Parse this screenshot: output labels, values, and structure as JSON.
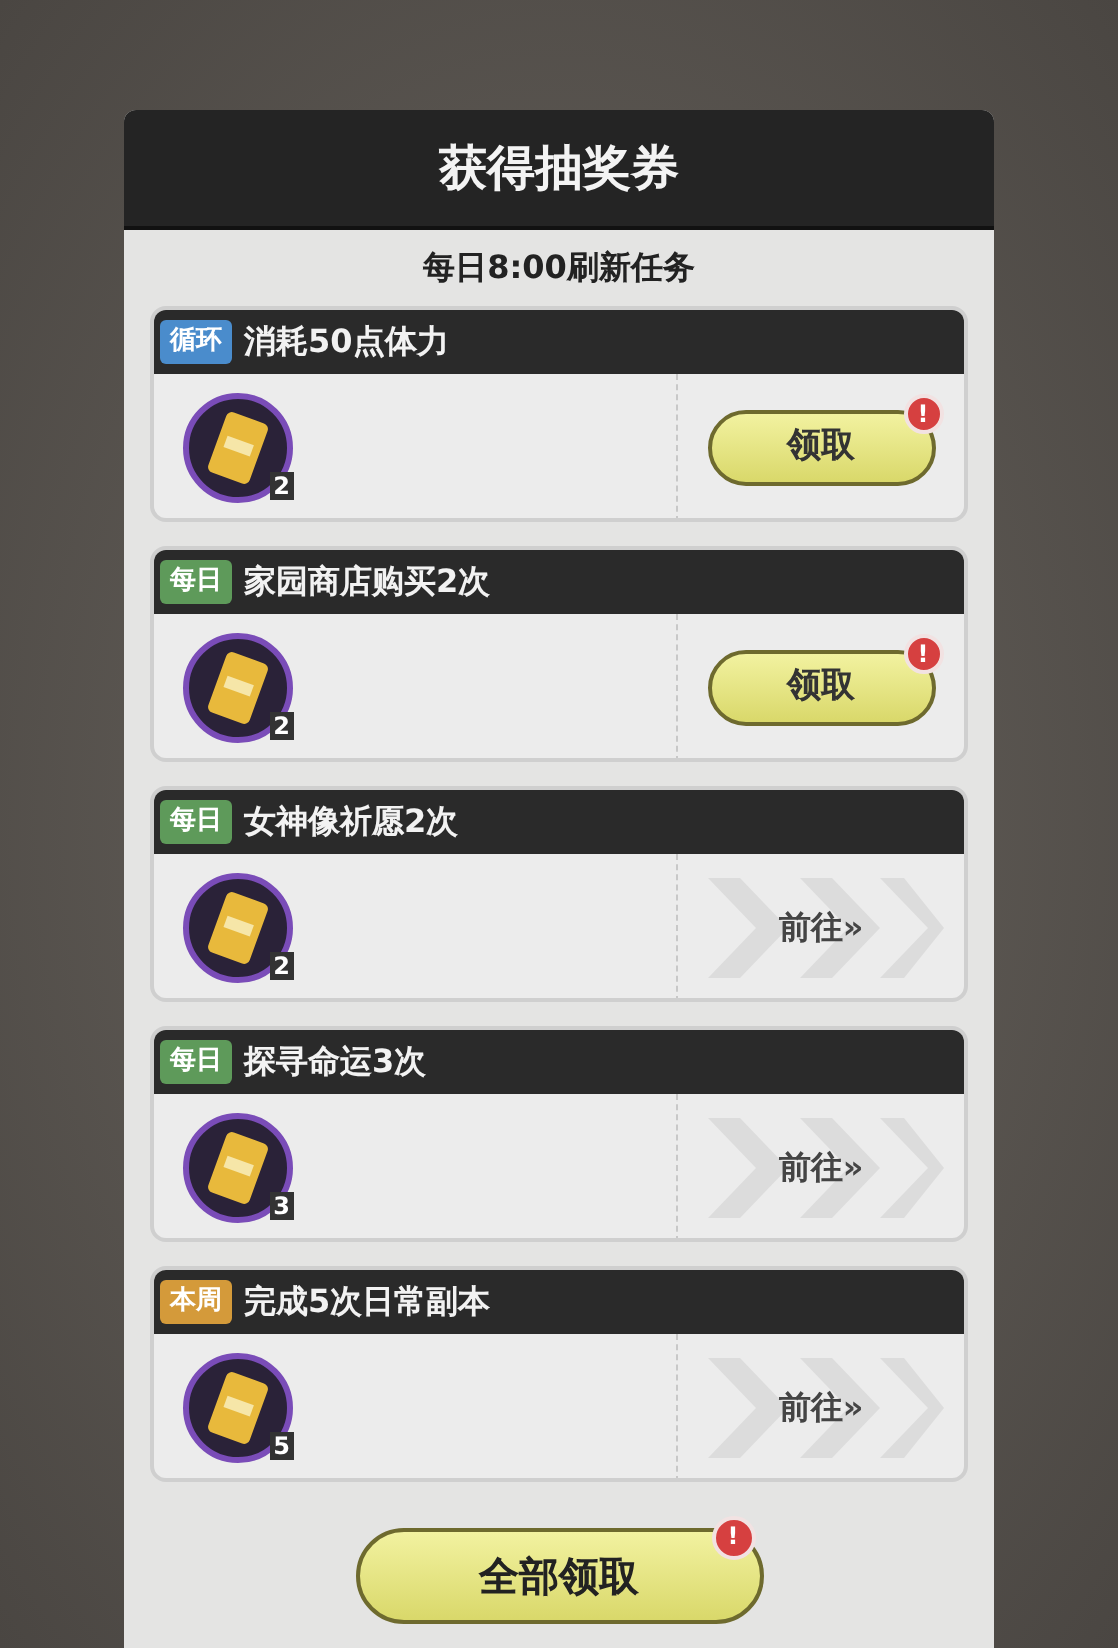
{
  "dialog": {
    "title": "获得抽奖券",
    "subtitle": "每日8:00刷新任务"
  },
  "tasks": [
    {
      "tag": "循环",
      "color": "#4a8ccc",
      "title": "消耗50点体力",
      "reward_count": "2",
      "kind": "claim",
      "action": "领取",
      "alert": "!"
    },
    {
      "tag": "每日",
      "color": "#5e9a5a",
      "title": "家园商店购买2次",
      "reward_count": "2",
      "kind": "claim",
      "action": "领取",
      "alert": "!"
    },
    {
      "tag": "每日",
      "color": "#5e9a5a",
      "title": "女神像祈愿2次",
      "reward_count": "2",
      "kind": "go",
      "action": "前往»"
    },
    {
      "tag": "每日",
      "color": "#5e9a5a",
      "title": "探寻命运3次",
      "reward_count": "3",
      "kind": "go",
      "action": "前往»"
    },
    {
      "tag": "本周",
      "color": "#d49a3a",
      "title": "完成5次日常副本",
      "reward_count": "5",
      "kind": "go",
      "action": "前往»"
    }
  ],
  "claim_all": {
    "label": "全部领取",
    "alert": "!"
  }
}
